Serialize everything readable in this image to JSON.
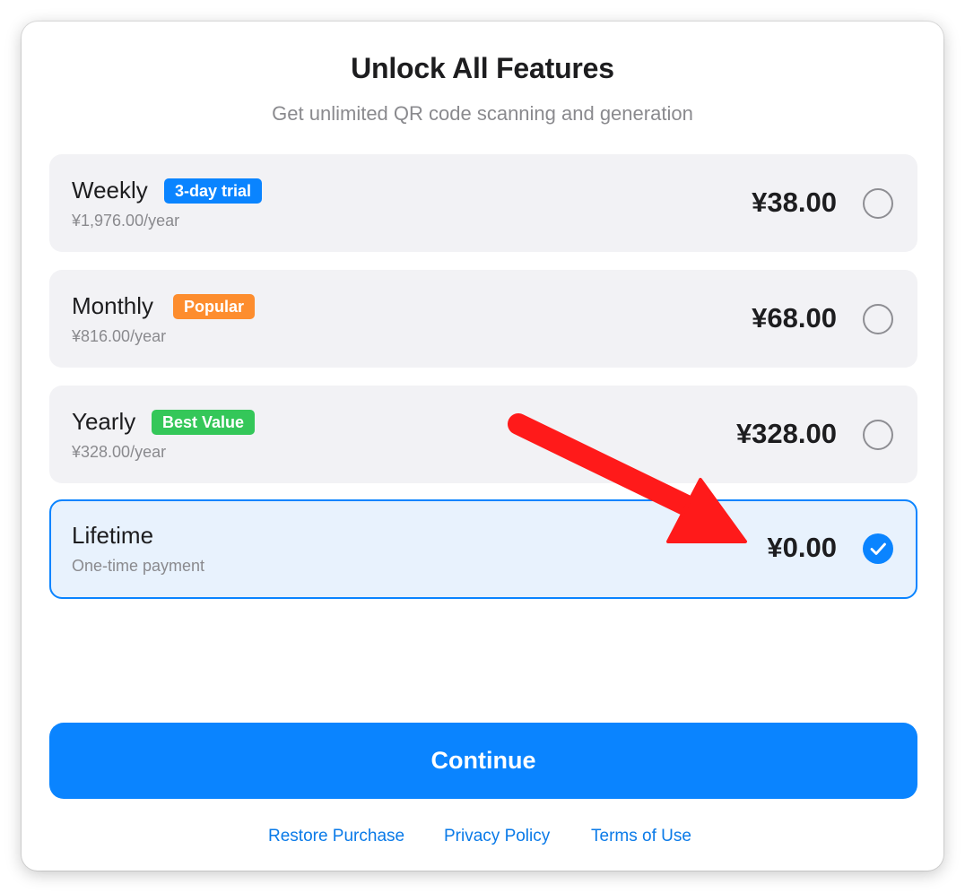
{
  "header": {
    "title": "Unlock All Features",
    "subtitle": "Get unlimited QR code scanning and generation"
  },
  "plans": [
    {
      "name": "Weekly",
      "badge": "3-day trial",
      "badge_color": "#0a84ff",
      "subtext": "¥1,976.00/year",
      "price": "¥38.00",
      "selected": false
    },
    {
      "name": "Monthly",
      "badge": "Popular",
      "badge_color": "#fd8d2e",
      "subtext": "¥816.00/year",
      "price": "¥68.00",
      "selected": false
    },
    {
      "name": "Yearly",
      "badge": "Best Value",
      "badge_color": "#34c759",
      "subtext": "¥328.00/year",
      "price": "¥328.00",
      "selected": false
    },
    {
      "name": "Lifetime",
      "subtext": "One-time payment",
      "price": "¥0.00",
      "selected": true
    }
  ],
  "actions": {
    "continue_label": "Continue"
  },
  "footer": {
    "restore_label": "Restore Purchase",
    "privacy_label": "Privacy Policy",
    "terms_label": "Terms of Use"
  },
  "colors": {
    "accent": "#0a84ff",
    "annotation_arrow": "#ff1a1a"
  },
  "icons": {
    "radio_unchecked": "radio-empty-icon",
    "radio_checked": "checkmark-circle-icon",
    "annotation": "red-arrow-annotation"
  }
}
